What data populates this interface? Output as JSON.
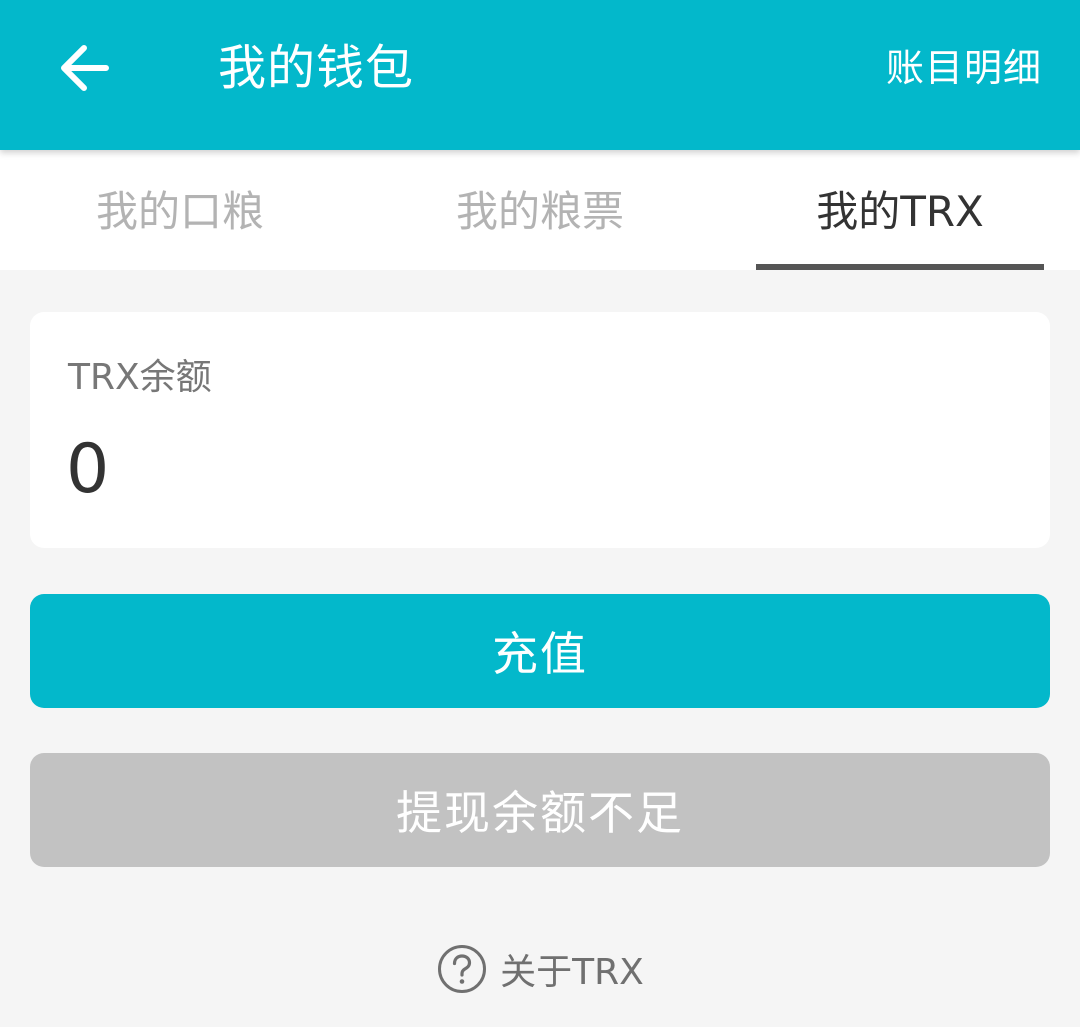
{
  "header": {
    "title": "我的钱包",
    "action_label": "账目明细",
    "back_icon": "arrow-left-icon",
    "background_color": "#03b8cb"
  },
  "tabs": [
    {
      "label": "我的口粮",
      "active": false
    },
    {
      "label": "我的粮票",
      "active": false
    },
    {
      "label": "我的TRX",
      "active": true
    }
  ],
  "balance": {
    "label": "TRX余额",
    "value": "0"
  },
  "buttons": {
    "recharge_label": "充值",
    "withdraw_label": "提现余额不足"
  },
  "about": {
    "icon": "question-circle-icon",
    "label": "关于TRX"
  },
  "colors": {
    "accent": "#03b8cb",
    "disabled": "#c2c2c2",
    "page_background": "#f5f5f5"
  }
}
